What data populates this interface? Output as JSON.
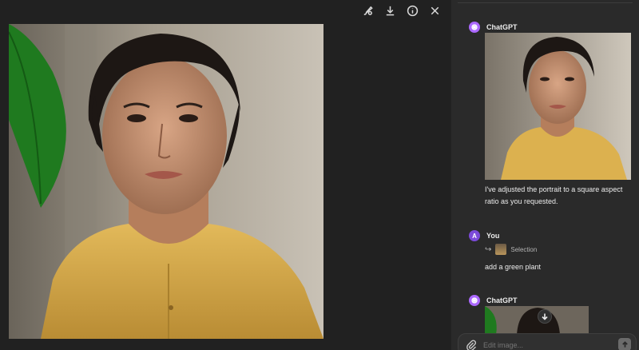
{
  "toolbar": {
    "icons": [
      "edit-brush-icon",
      "download-icon",
      "info-icon",
      "close-icon"
    ]
  },
  "chat": {
    "messages": [
      {
        "sender": "ChatGPT",
        "text": "I've adjusted the portrait to a square aspect ratio as you requested."
      },
      {
        "sender": "You",
        "avatar_letter": "A",
        "selection_label": "Selection",
        "text": "add a green plant"
      },
      {
        "sender": "ChatGPT"
      }
    ],
    "composer": {
      "placeholder": "Edit image..."
    }
  },
  "colors": {
    "background": "#212121",
    "panel": "#2a2a2a",
    "gpt_avatar": "#ab68ff",
    "user_avatar": "#7b4ad9",
    "shirt": "#d9b04f",
    "leaf": "#1f7a1f"
  }
}
